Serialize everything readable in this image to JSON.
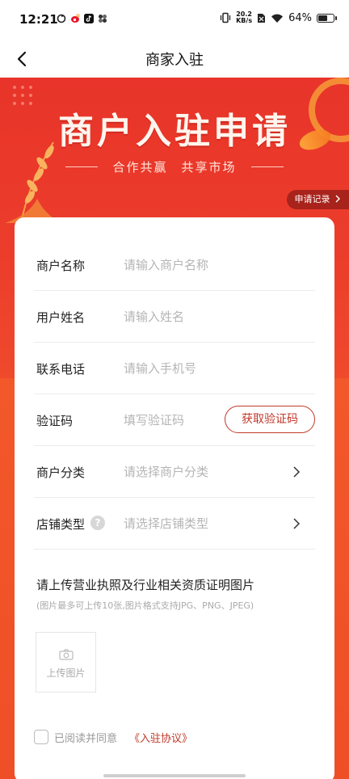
{
  "status_bar": {
    "time": "12:21",
    "net_speed_top": "20.2",
    "net_speed_bottom": "KB/s",
    "battery_text": "64%",
    "battery_level": 0.64,
    "icons": [
      "sync-icon",
      "weibo-icon",
      "tiktok-icon",
      "pinwheel-icon",
      "vibrate-icon",
      "sim-icon",
      "wifi-icon",
      "battery-icon"
    ]
  },
  "nav": {
    "title": "商家入驻",
    "back_icon": "chevron-left-icon"
  },
  "hero": {
    "title": "商户入驻申请",
    "subtitle": "合作共赢　共享市场",
    "records_label": "申请记录",
    "records_icon": "chevron-right-icon"
  },
  "form": {
    "fields": [
      {
        "label": "商户名称",
        "placeholder": "请输入商户名称"
      },
      {
        "label": "用户姓名",
        "placeholder": "请输入姓名"
      },
      {
        "label": "联系电话",
        "placeholder": "请输入手机号"
      },
      {
        "label": "验证码",
        "placeholder": "填写验证码",
        "action": "获取验证码"
      },
      {
        "label": "商户分类",
        "placeholder": "请选择商户分类"
      },
      {
        "label": "店铺类型",
        "placeholder": "请选择店铺类型",
        "help": "?"
      }
    ]
  },
  "upload": {
    "title": "请上传营业执照及行业相关资质证明图片",
    "hint": "(图片最多可上传10张,图片格式支持JPG、PNG、JPEG)",
    "button_label": "上传图片",
    "icon": "camera-icon"
  },
  "agreement": {
    "text": "已阅读并同意",
    "link": "《入驻协议》",
    "checked": false
  },
  "colors": {
    "brand_red": "#e8342a",
    "accent_red": "#c0392b",
    "hero_bottom": "#f2582a",
    "placeholder": "#b5b5b5"
  }
}
